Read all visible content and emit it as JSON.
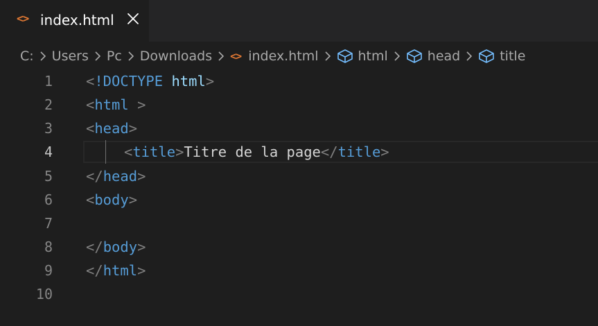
{
  "tab": {
    "icon": "html-file-icon",
    "label": "index.html",
    "close_icon": "close-icon"
  },
  "breadcrumb": {
    "items": [
      {
        "label": "C:",
        "icon": null
      },
      {
        "label": "Users",
        "icon": null
      },
      {
        "label": "Pc",
        "icon": null
      },
      {
        "label": "Downloads",
        "icon": null
      },
      {
        "label": "index.html",
        "icon": "html-file-icon"
      },
      {
        "label": "html",
        "icon": "symbol-field-icon"
      },
      {
        "label": "head",
        "icon": "symbol-field-icon"
      },
      {
        "label": "title",
        "icon": "symbol-field-icon"
      }
    ],
    "separator_icon": "chevron-right-icon"
  },
  "editor": {
    "current_line": 4,
    "lines": [
      {
        "number": "1",
        "lt": "<",
        "kw": "!DOCTYPE",
        "sp": " ",
        "attr": "html",
        "gt": ">"
      },
      {
        "number": "2",
        "lt": "<",
        "tag": "html",
        "sp": " ",
        "gt": ">"
      },
      {
        "number": "3",
        "lt": "<",
        "tag": "head",
        "gt": ">"
      },
      {
        "number": "4",
        "lt1": "<",
        "tag1": "title",
        "gt1": ">",
        "text": "Titre de la page",
        "lt2": "</",
        "tag2": "title",
        "gt2": ">"
      },
      {
        "number": "5",
        "lt": "</",
        "tag": "head",
        "gt": ">"
      },
      {
        "number": "6",
        "lt": "<",
        "tag": "body",
        "gt": ">"
      },
      {
        "number": "7"
      },
      {
        "number": "8",
        "lt": "</",
        "tag": "body",
        "gt": ">"
      },
      {
        "number": "9",
        "lt": "</",
        "tag": "html",
        "gt": ">"
      },
      {
        "number": "10"
      }
    ]
  },
  "colors": {
    "background": "#1e1e1e",
    "tab_bar": "#252526",
    "tag": "#569cd6",
    "attribute": "#9cdcfe",
    "punctuation": "#808080",
    "text": "#d4d4d4",
    "html_icon": "#e37933",
    "symbol_icon": "#75beff",
    "line_number": "#858585",
    "line_number_active": "#c6c6c6"
  }
}
